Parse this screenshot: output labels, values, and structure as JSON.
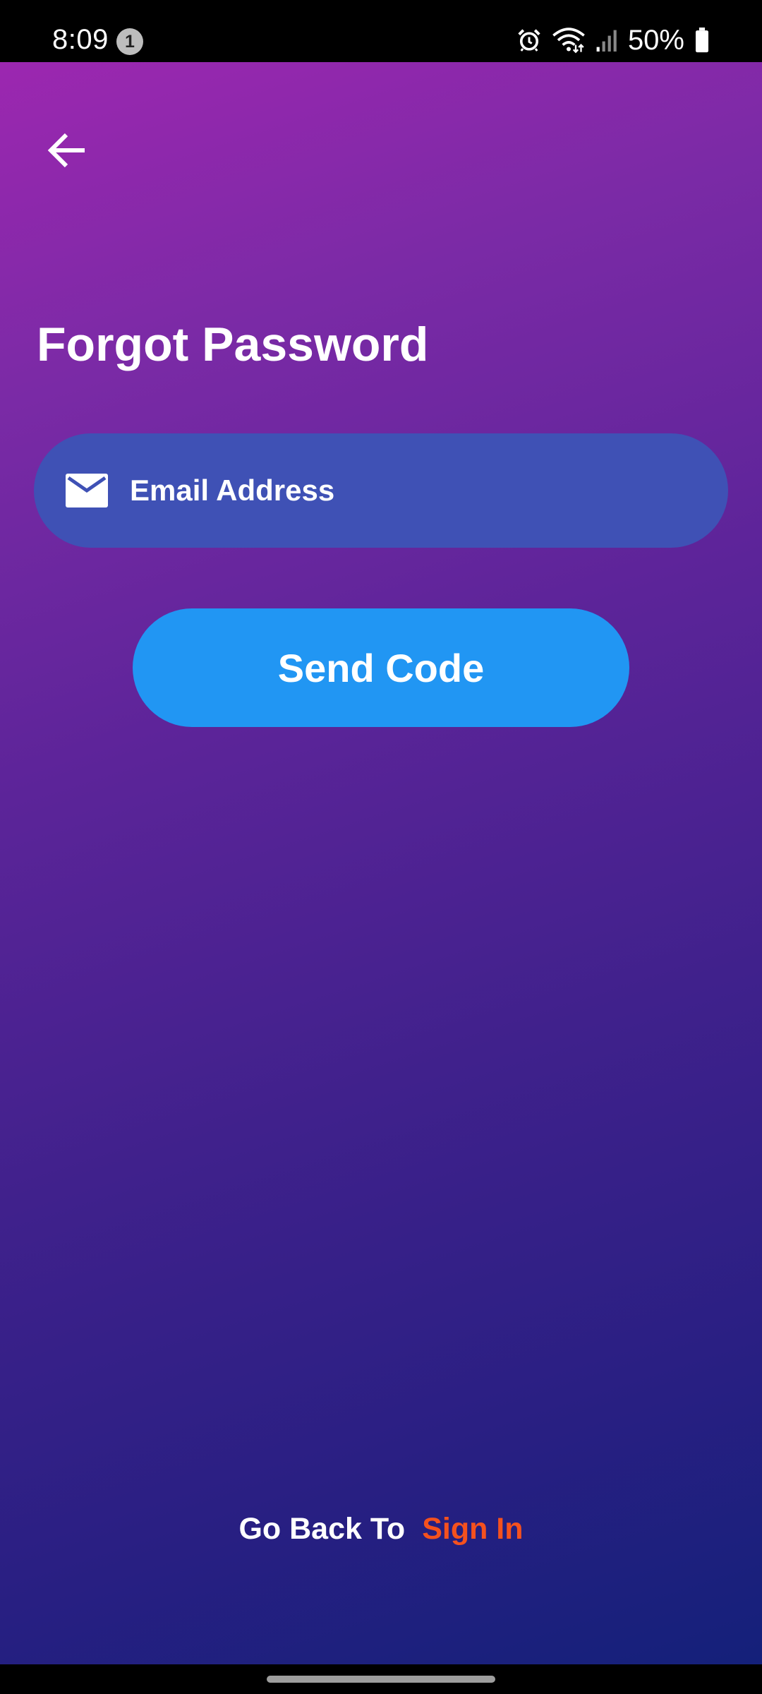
{
  "status_bar": {
    "time": "8:09",
    "notification_count": "1",
    "battery_percent": "50%",
    "icons": [
      "alarm-icon",
      "wifi-icon",
      "signal-icon",
      "battery-icon"
    ]
  },
  "header": {
    "back_icon": "arrow-left-icon"
  },
  "page": {
    "title": "Forgot Password"
  },
  "email": {
    "icon": "mail-icon",
    "placeholder": "Email Address",
    "value": ""
  },
  "send_button": {
    "label": "Send Code"
  },
  "footer": {
    "prefix": "Go Back To",
    "link": "Sign In"
  },
  "colors": {
    "gradient_start": "#9c27b0",
    "gradient_end": "#14207a",
    "email_field_bg": "#3f51b5",
    "button_bg": "#2196f3",
    "link_color": "#f4511e"
  }
}
